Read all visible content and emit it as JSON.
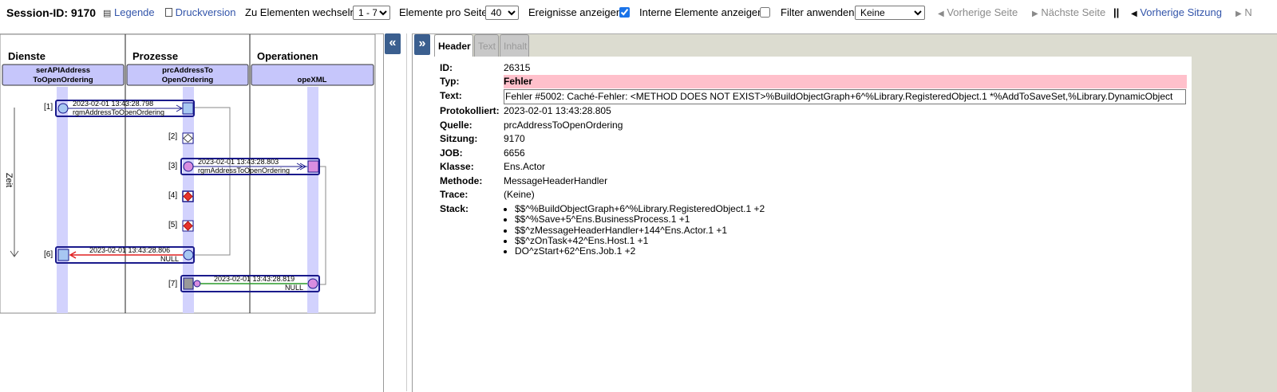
{
  "toolbar": {
    "session_label": "Session-ID: 9170",
    "legend": "Legende",
    "print": "Druckversion",
    "goto_label": "Zu Elementen wechseln",
    "goto_value": "1 - 7",
    "per_page_label": "Elemente pro Seite",
    "per_page_value": "40",
    "show_events_label": "Ereignisse anzeigen",
    "show_events_checked": true,
    "internal_label": "Interne Elemente anzeigen",
    "internal_checked": false,
    "filter_label": "Filter anwenden",
    "filter_value": "Keine",
    "prev_page": "Vorherige Seite",
    "next_page": "Nächste Seite",
    "divider": "||",
    "prev_session": "Vorherige Sitzung",
    "next_session": "N"
  },
  "diagram": {
    "columns": [
      {
        "title": "Dienste",
        "header": [
          "serAPIAddress",
          "ToOpenOrdering"
        ]
      },
      {
        "title": "Prozesse",
        "header": [
          "prcAddressTo",
          "OpenOrdering"
        ]
      },
      {
        "title": "Operationen",
        "header": [
          "opeXML"
        ]
      }
    ],
    "time_label": "Zeit",
    "steps": [
      {
        "num": "[1]",
        "time": "2023-02-01 13:43:28.798",
        "name": "rgmAddressToOpenOrdering"
      },
      {
        "num": "[2]"
      },
      {
        "num": "[3]",
        "time": "2023-02-01 13:43:28.803",
        "name": "rgmAddressToOpenOrdering"
      },
      {
        "num": "[4]"
      },
      {
        "num": "[5]"
      },
      {
        "num": "[6]",
        "time": "2023-02-01 13:43:28.806",
        "name": "NULL"
      },
      {
        "num": "[7]",
        "time": "2023-02-01 13:43:28.819",
        "name": "NULL"
      }
    ],
    "collapse_icon": "«"
  },
  "detail": {
    "expand_icon": "»",
    "tabs": [
      "Header",
      "Text",
      "Inhalt"
    ],
    "fields": {
      "id": {
        "label": "ID:",
        "value": "26315"
      },
      "typ": {
        "label": "Typ:",
        "value": "Fehler"
      },
      "text": {
        "label": "Text:",
        "value": "Fehler #5002: Caché-Fehler: <METHOD DOES NOT EXIST>%BuildObjectGraph+6^%Library.RegisteredObject.1 *%AddToSaveSet,%Library.DynamicObject"
      },
      "protokolliert": {
        "label": "Protokolliert:",
        "value": "2023-02-01 13:43:28.805"
      },
      "quelle": {
        "label": "Quelle:",
        "value": "prcAddressToOpenOrdering"
      },
      "sitzung": {
        "label": "Sitzung:",
        "value": "9170"
      },
      "job": {
        "label": "JOB:",
        "value": "6656"
      },
      "klasse": {
        "label": "Klasse:",
        "value": "Ens.Actor"
      },
      "methode": {
        "label": "Methode:",
        "value": "MessageHeaderHandler"
      },
      "trace": {
        "label": "Trace:",
        "value": "(Keine)"
      },
      "stack": {
        "label": "Stack:",
        "items": [
          "$$^%BuildObjectGraph+6^%Library.RegisteredObject.1 +2",
          "$$^%Save+5^Ens.BusinessProcess.1 +1",
          "$$^zMessageHeaderHandler+144^Ens.Actor.1 +1",
          "$$^zOnTask+42^Ens.Host.1 +1",
          "DO^zStart+62^Ens.Job.1 +2"
        ]
      }
    }
  },
  "colors": {
    "accent": "#3b5f8f",
    "header_box": "#c6c6fb",
    "lifeline": "#d2d2fd",
    "error_bg": "#ffc0cb",
    "link": "#3355aa"
  }
}
